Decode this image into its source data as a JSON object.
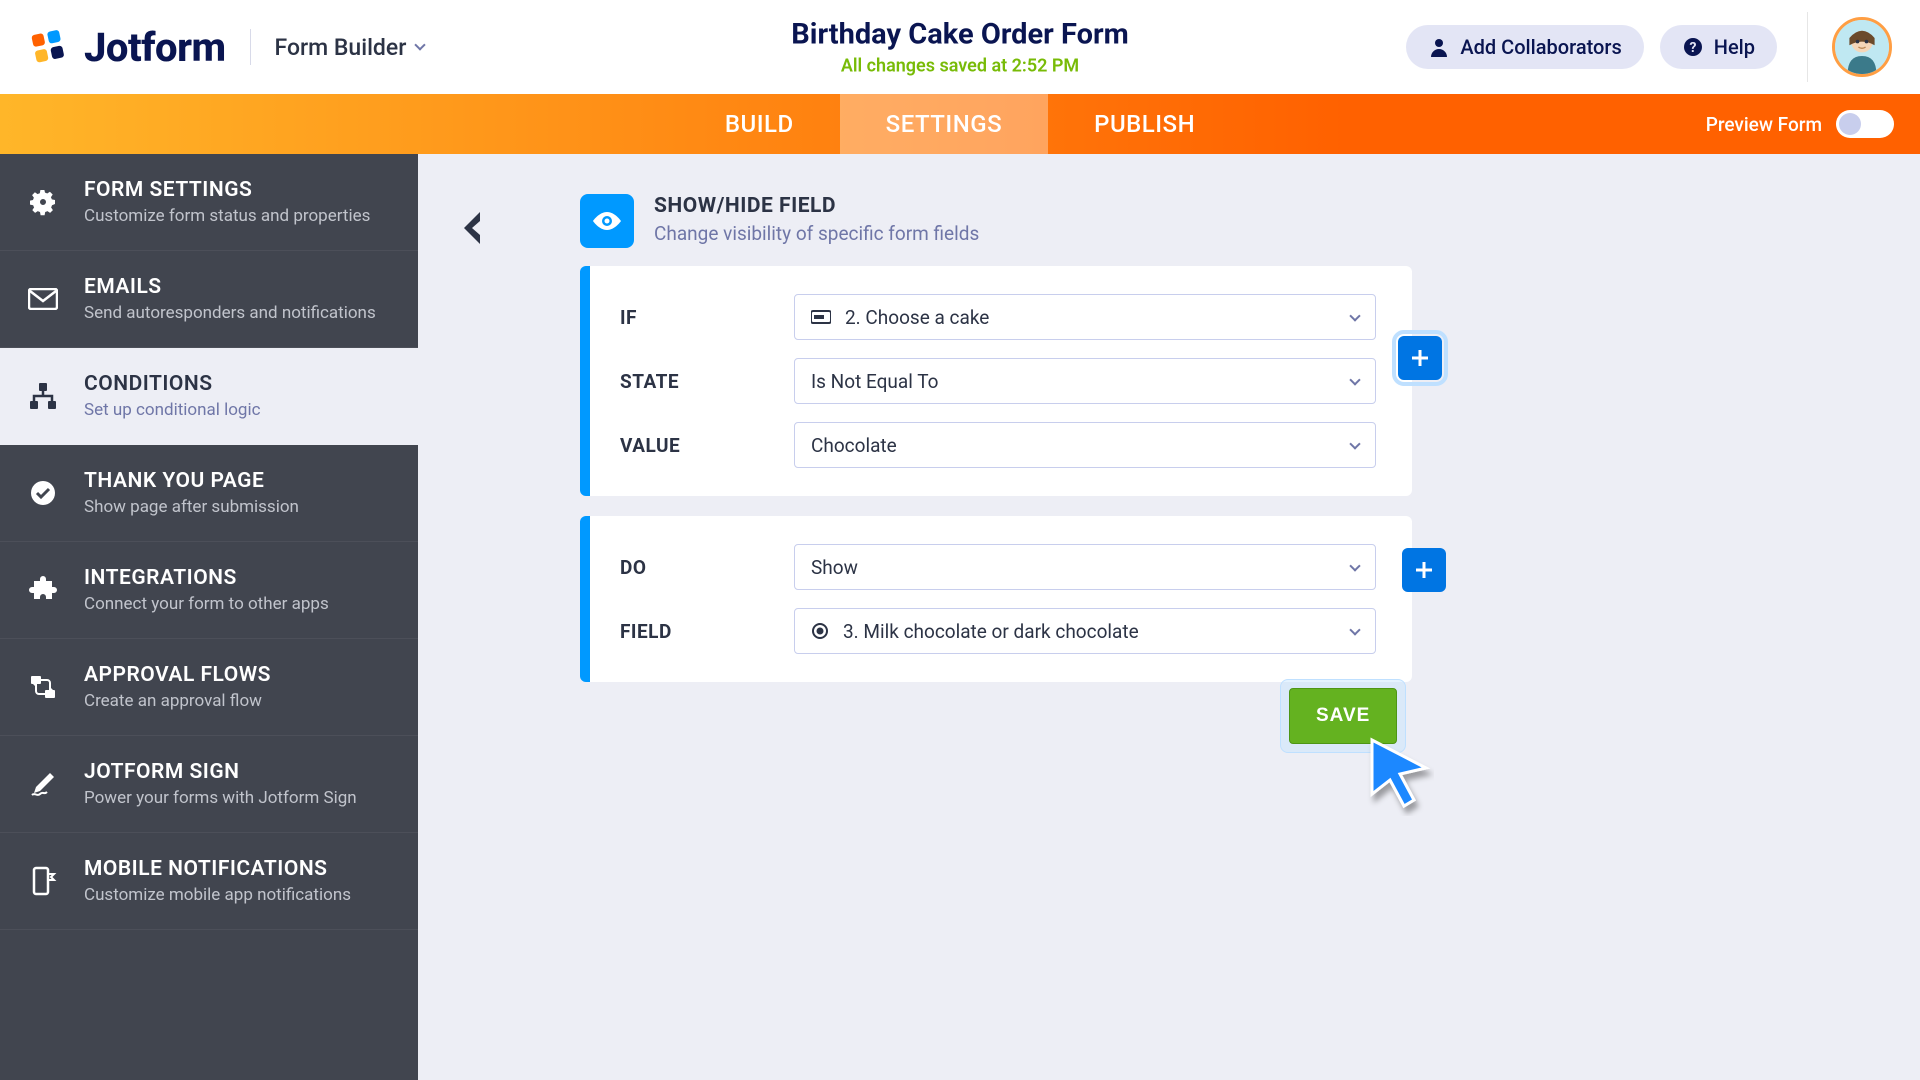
{
  "brand": {
    "name": "Jotform",
    "form_builder_label": "Form Builder"
  },
  "header": {
    "form_title": "Birthday Cake Order Form",
    "save_status": "All changes saved at 2:52 PM",
    "add_collaborators": "Add Collaborators",
    "help": "Help"
  },
  "tabs": {
    "build": "BUILD",
    "settings": "SETTINGS",
    "publish": "PUBLISH",
    "preview_label": "Preview Form"
  },
  "sidebar": {
    "items": [
      {
        "title": "FORM SETTINGS",
        "sub": "Customize form status and properties"
      },
      {
        "title": "EMAILS",
        "sub": "Send autoresponders and notifications"
      },
      {
        "title": "CONDITIONS",
        "sub": "Set up conditional logic"
      },
      {
        "title": "THANK YOU PAGE",
        "sub": "Show page after submission"
      },
      {
        "title": "INTEGRATIONS",
        "sub": "Connect your form to other apps"
      },
      {
        "title": "APPROVAL FLOWS",
        "sub": "Create an approval flow"
      },
      {
        "title": "JOTFORM SIGN",
        "sub": "Power your forms with Jotform Sign"
      },
      {
        "title": "MOBILE NOTIFICATIONS",
        "sub": "Customize mobile app notifications"
      }
    ]
  },
  "panel": {
    "title": "SHOW/HIDE FIELD",
    "subtitle": "Change visibility of specific form fields",
    "if_block": {
      "rows": [
        {
          "label": "IF",
          "value": "2. Choose a cake"
        },
        {
          "label": "STATE",
          "value": "Is Not Equal To"
        },
        {
          "label": "VALUE",
          "value": "Chocolate"
        }
      ]
    },
    "do_block": {
      "rows": [
        {
          "label": "DO",
          "value": "Show"
        },
        {
          "label": "FIELD",
          "value": "3. Milk chocolate or dark chocolate"
        }
      ]
    },
    "save_label": "SAVE"
  }
}
